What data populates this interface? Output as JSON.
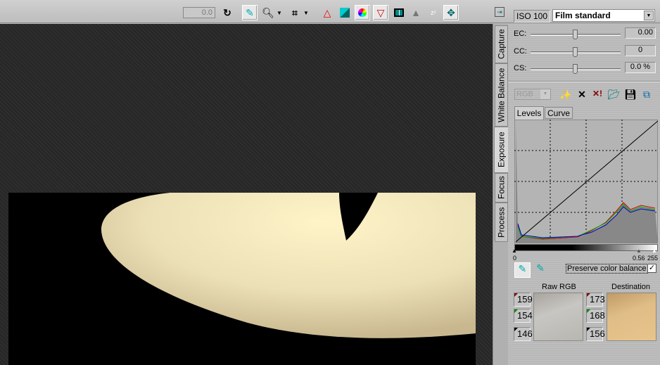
{
  "toolbar": {
    "angle_value": "0.0",
    "tools": [
      "rotate-icon",
      "eyedropper-icon",
      "zoom-icon",
      "crop-icon",
      "highlight-warning-icon",
      "shadow-icon",
      "color-wheel-icon",
      "gray-point-icon",
      "split-view-icon",
      "triangle-icon",
      "sleep-icon",
      "fit-icon"
    ]
  },
  "side_tabs": [
    "Capture",
    "White Balance",
    "Exposure",
    "Focus",
    "Process"
  ],
  "active_tab": "Exposure",
  "panel": {
    "iso": "ISO 100",
    "film_mode": "Film standard",
    "ec_label": "EC:",
    "ec_value": "0.00",
    "cc_label": "CC:",
    "cc_value": "0",
    "cs_label": "CS:",
    "cs_value": "0.0 %",
    "channel": "RGB",
    "tabs": [
      "Levels",
      "Curve"
    ],
    "levels": {
      "black": "0",
      "gamma": "0.56",
      "white": "255"
    },
    "preserve_label": "Preserve color balance",
    "preserve_checked": true,
    "raw_label": "Raw RGB",
    "dest_label": "Destination",
    "raw": {
      "r": "159",
      "g": "154",
      "b": "146"
    },
    "dest": {
      "r": "173",
      "g": "168",
      "b": "156"
    },
    "colors": {
      "raw_swatch": "#bdbab4",
      "dest_swatch": "#dfbd86"
    }
  }
}
